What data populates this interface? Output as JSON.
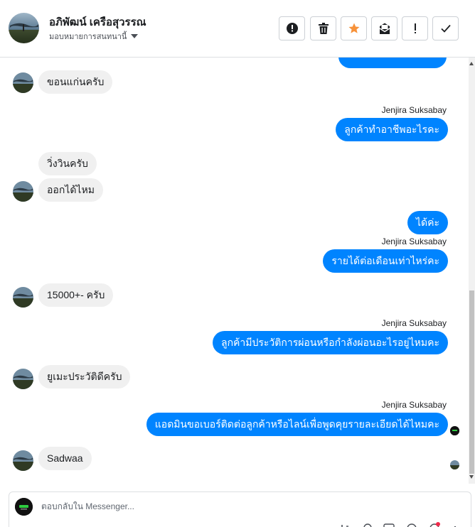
{
  "header": {
    "contact_name": "อภิพัฒน์ เครือสุวรรณ",
    "assign_label": "มอบหมายการสนทนานี้",
    "buttons": [
      {
        "name": "spam",
        "icon": "alert-circle-icon"
      },
      {
        "name": "delete",
        "icon": "trash-icon"
      },
      {
        "name": "star",
        "icon": "star-icon"
      },
      {
        "name": "mark-unread",
        "icon": "envelope-icon"
      },
      {
        "name": "follow-up",
        "icon": "exclamation-icon"
      },
      {
        "name": "done",
        "icon": "checkmark-icon"
      }
    ]
  },
  "conversation": {
    "messages": [
      {
        "id": "m1",
        "direction": "in",
        "text": "ขอนแก่นครับ"
      },
      {
        "id": "m2",
        "direction": "out",
        "sender": "Jenjira Suksabay",
        "text": "ลูกค้าทำอาชีพอะไรคะ"
      },
      {
        "id": "m3",
        "direction": "in",
        "text": "วิ่งวินครับ"
      },
      {
        "id": "m4",
        "direction": "in",
        "text": "ออกได้ไหม"
      },
      {
        "id": "m5",
        "direction": "out",
        "text": "ได้ค่ะ"
      },
      {
        "id": "m6",
        "direction": "out",
        "sender": "Jenjira Suksabay",
        "text": "รายได้ต่อเดือนเท่าไหร่คะ"
      },
      {
        "id": "m7",
        "direction": "in",
        "text": "15000+- ครับ"
      },
      {
        "id": "m8",
        "direction": "out",
        "sender": "Jenjira Suksabay",
        "text": "ลูกค้ามีประวัติการผ่อนหรือกำลังผ่อนอะไรอยู่ไหมคะ"
      },
      {
        "id": "m9",
        "direction": "in",
        "text": "ยูเมะประวัติดีครับ"
      },
      {
        "id": "m10",
        "direction": "out",
        "sender": "Jenjira Suksabay",
        "text": "แอดมินขอเบอร์ติดต่อลูกค้าหรือไลน์เพื่อพูดคุยรายละเอียดได้ไหมคะ"
      },
      {
        "id": "m11",
        "direction": "in",
        "text": "Sadwaa"
      }
    ]
  },
  "composer": {
    "placeholder": "ตอบกลับใน Messenger...",
    "value": ""
  },
  "colors": {
    "outgoing_bubble": "#0084ff",
    "incoming_bubble": "#f0f0f0",
    "star": "#f7923a"
  }
}
